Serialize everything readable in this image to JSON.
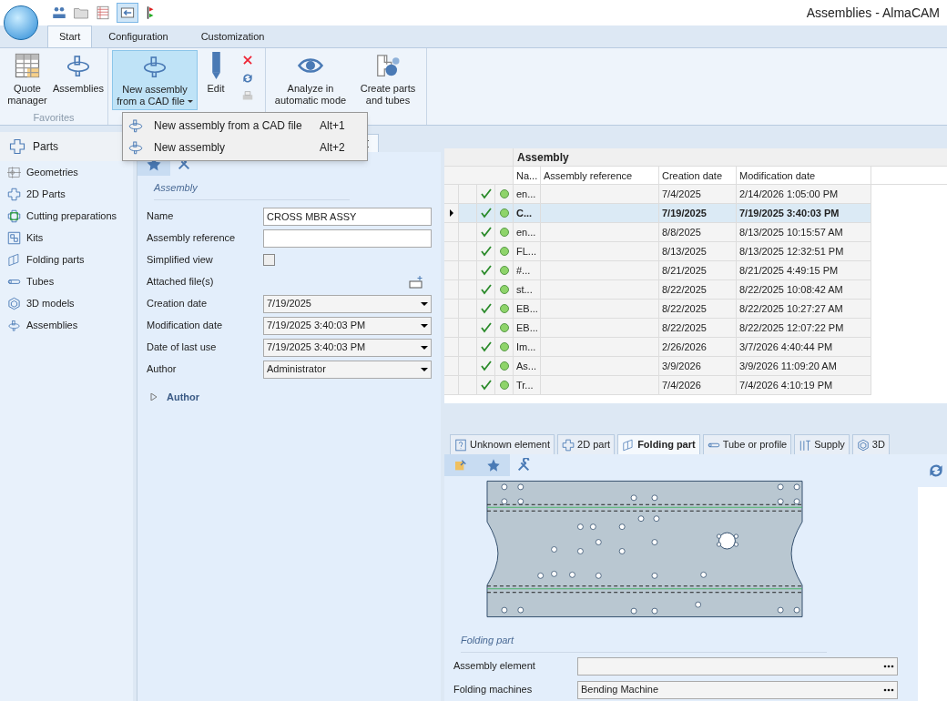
{
  "window": {
    "title": "Assemblies - AlmaCAM"
  },
  "ribbon_tabs": [
    {
      "label": "Start",
      "selected": true
    },
    {
      "label": "Configuration",
      "selected": false
    },
    {
      "label": "Customization",
      "selected": false
    }
  ],
  "ribbon_groups": [
    {
      "label": "Favorites",
      "buttons": [
        {
          "label": "Quote manager",
          "highlighted": false,
          "dropdown": false
        },
        {
          "label": "Assemblies",
          "highlighted": false,
          "dropdown": false
        }
      ]
    },
    {
      "buttons": [
        {
          "label": "New assembly from a CAD file",
          "highlighted": true,
          "dropdown": true
        },
        {
          "label": "Edit",
          "highlighted": false,
          "dropdown": false
        }
      ]
    },
    {
      "buttons": [
        {
          "label": "Analyze in automatic mode",
          "highlighted": false,
          "dropdown": false
        },
        {
          "label": "Create parts and tubes",
          "highlighted": false,
          "dropdown": false
        }
      ]
    }
  ],
  "menu": [
    {
      "label": "New assembly from a CAD file",
      "shortcut": "Alt+1"
    },
    {
      "label": "New assembly",
      "shortcut": "Alt+2"
    }
  ],
  "sidebar": {
    "header": "Parts",
    "items": [
      {
        "label": "Geometries"
      },
      {
        "label": "2D Parts"
      },
      {
        "label": "Cutting preparations"
      },
      {
        "label": "Kits"
      },
      {
        "label": "Folding parts"
      },
      {
        "label": "Tubes"
      },
      {
        "label": "3D models"
      },
      {
        "label": "Assemblies"
      }
    ]
  },
  "form": {
    "section": "Assembly",
    "fields": [
      {
        "label": "Name",
        "kind": "text",
        "value": "CROSS MBR ASSY"
      },
      {
        "label": "Assembly reference",
        "kind": "text"
      },
      {
        "label": "Simplified view",
        "kind": "checkbox",
        "checked": false
      },
      {
        "label": "Attached file(s)",
        "kind": "attach"
      },
      {
        "label": "Creation date",
        "kind": "combo",
        "value": "7/19/2025"
      },
      {
        "label": "Modification date",
        "kind": "combo",
        "value": "7/19/2025 3:40:03 PM"
      },
      {
        "label": "Date of last use",
        "kind": "combo",
        "value": "7/19/2025 3:40:03 PM"
      },
      {
        "label": "Author",
        "kind": "combo",
        "value": "Administrator"
      }
    ],
    "expander": {
      "label": "Author",
      "expanded": false
    }
  },
  "table": {
    "group": "Assembly",
    "columns": [
      "Na...",
      "Assembly reference",
      "Creation date",
      "Modification date"
    ],
    "rows": [
      {
        "name": "en...",
        "created": "7/4/2025",
        "modified": "2/14/2026 1:05:00 PM",
        "selected": false
      },
      {
        "name": "C...",
        "created": "7/19/2025",
        "modified": "7/19/2025 3:40:03 PM",
        "selected": true
      },
      {
        "name": "en...",
        "created": "8/8/2025",
        "modified": "8/13/2025 10:15:57 AM",
        "selected": false
      },
      {
        "name": "FL...",
        "created": "8/13/2025",
        "modified": "8/13/2025 12:32:51 PM",
        "selected": false
      },
      {
        "name": "#...",
        "created": "8/21/2025",
        "modified": "8/21/2025 4:49:15 PM",
        "selected": false
      },
      {
        "name": "st...",
        "created": "8/22/2025",
        "modified": "8/22/2025 10:08:42 AM",
        "selected": false
      },
      {
        "name": "EB...",
        "created": "8/22/2025",
        "modified": "8/22/2025 10:27:27 AM",
        "selected": false
      },
      {
        "name": "EB...",
        "created": "8/22/2025",
        "modified": "8/22/2025 12:07:22 PM",
        "selected": false
      },
      {
        "name": "Im...",
        "created": "2/26/2026",
        "modified": "3/7/2026 4:40:44 PM",
        "selected": false
      },
      {
        "name": "As...",
        "created": "3/9/2026",
        "modified": "3/9/2026 11:09:20 AM",
        "selected": false
      },
      {
        "name": "Tr...",
        "created": "7/4/2026",
        "modified": "7/4/2026 4:10:19 PM",
        "selected": false
      }
    ]
  },
  "element_tabs": [
    {
      "label": "Unknown element",
      "selected": false
    },
    {
      "label": "2D part",
      "selected": false
    },
    {
      "label": "Folding part",
      "selected": true
    },
    {
      "label": "Tube or profile",
      "selected": false
    },
    {
      "label": "Supply",
      "selected": false
    },
    {
      "label": "3D",
      "selected": false
    }
  ],
  "folding": {
    "section": "Folding part",
    "fields": [
      {
        "label": "Assembly element"
      },
      {
        "label": "Folding machines",
        "value": "Bending Machine"
      }
    ]
  }
}
